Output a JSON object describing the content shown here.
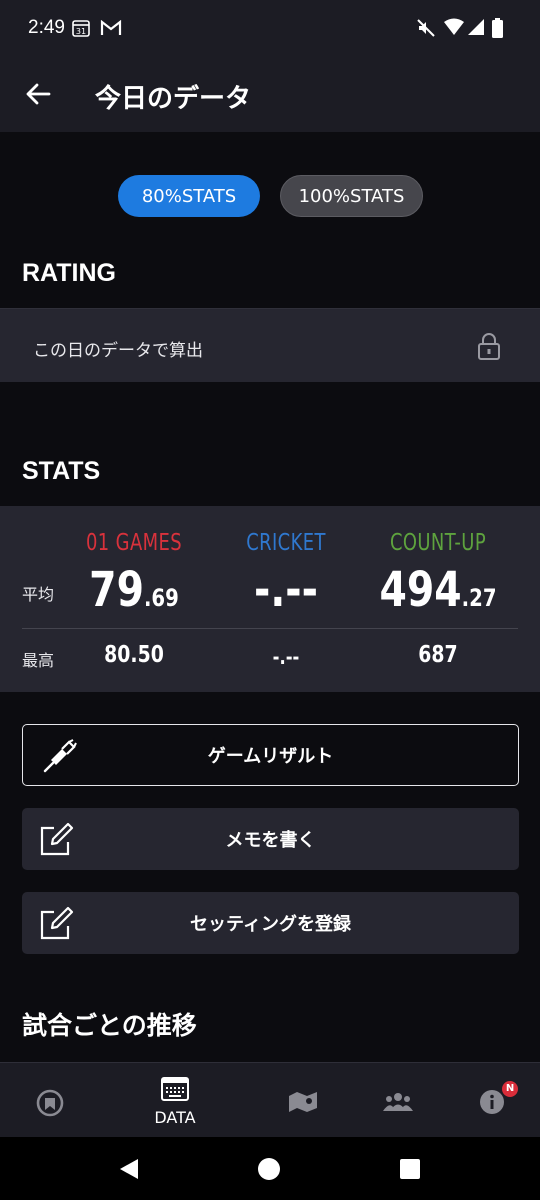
{
  "status_bar": {
    "time": "2:49",
    "calendar_day": "31"
  },
  "header": {
    "title": "今日のデータ"
  },
  "toggles": {
    "active": "80%STATS",
    "inactive": "100%STATS"
  },
  "rating": {
    "heading": "RATING",
    "row_text": "この日のデータで算出"
  },
  "stats": {
    "heading": "STATS",
    "columns": [
      {
        "name": "01 GAMES",
        "color": "#d9323c",
        "avg_int": "79",
        "avg_dec": ".69",
        "best": "80.50"
      },
      {
        "name": "CRICKET",
        "color": "#2f78cf",
        "avg_int": "-",
        "avg_dec": ".--",
        "best": "-.--"
      },
      {
        "name": "COUNT-UP",
        "color": "#5ea33e",
        "avg_int": "494",
        "avg_dec": ".27",
        "best": "687"
      }
    ],
    "avg_label": "平均",
    "best_label": "最高"
  },
  "actions": {
    "game_result": "ゲームリザルト",
    "write_memo": "メモを書く",
    "register_setting": "セッティングを登録"
  },
  "trend": {
    "heading": "試合ごとの推移"
  },
  "bottom_nav": {
    "active_label": "DATA",
    "badge": "N"
  }
}
